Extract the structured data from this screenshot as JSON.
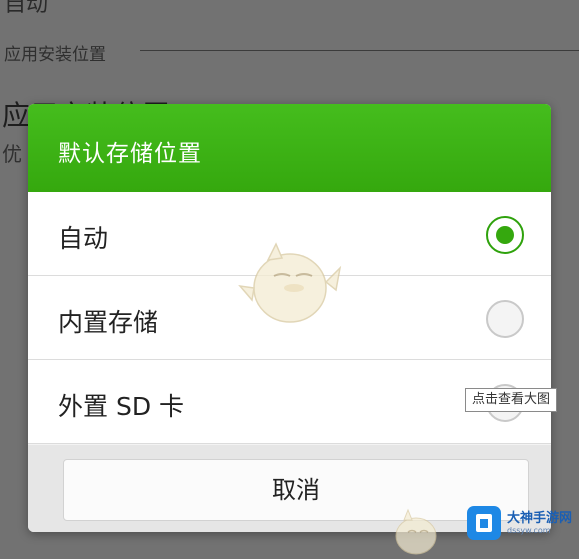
{
  "background": {
    "top_text": "自动",
    "section_label": "应用安装位置",
    "item_title": "应用安装位置",
    "item_subtitle": "优"
  },
  "dialog": {
    "title": "默认存储位置",
    "options": [
      {
        "label": "自动",
        "selected": true
      },
      {
        "label": "内置存储",
        "selected": false
      },
      {
        "label": "外置 SD 卡",
        "selected": false
      }
    ],
    "cancel_label": "取消"
  },
  "overlay": {
    "tooltip": "点击查看大图",
    "watermark_name": "大神手游网",
    "watermark_url": "dssyw.com"
  },
  "colors": {
    "accent": "#35a80e",
    "header_green": "#3db314",
    "dim_background": "#727272"
  }
}
